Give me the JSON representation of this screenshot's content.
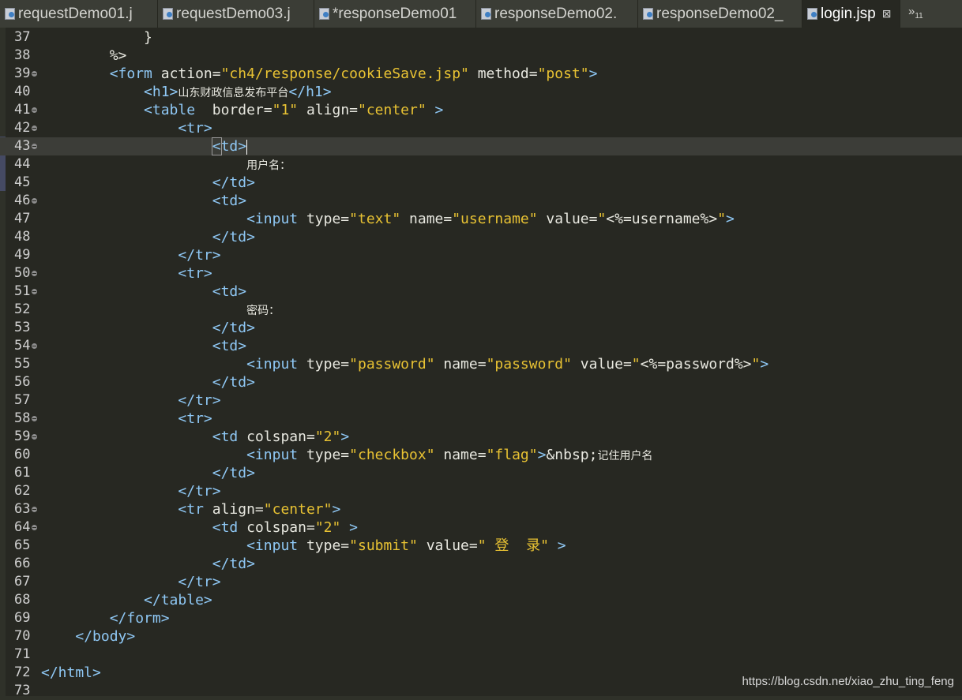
{
  "tabs": [
    {
      "label": "requestDemo01.j",
      "active": false
    },
    {
      "label": "requestDemo03.j",
      "active": false
    },
    {
      "label": "*responseDemo01",
      "active": false
    },
    {
      "label": "responseDemo02.",
      "active": false
    },
    {
      "label": "responseDemo02_",
      "active": false
    },
    {
      "label": "login.jsp",
      "active": true
    }
  ],
  "tab_close_glyph": "⊠",
  "overflow": {
    "glyph": "»",
    "count": "11"
  },
  "colors": {
    "tag": "#8fc8f5",
    "string": "#e8c233",
    "text": "#e8e8e0",
    "background": "#272822"
  },
  "lines": [
    {
      "n": "37",
      "fold": false,
      "segs": [
        [
          "x",
          "            }"
        ]
      ]
    },
    {
      "n": "38",
      "fold": false,
      "segs": [
        [
          "x",
          "        %>"
        ]
      ]
    },
    {
      "n": "39",
      "fold": true,
      "segs": [
        [
          "x",
          "        "
        ],
        [
          "t",
          "<form"
        ],
        [
          "a",
          " action="
        ],
        [
          "s",
          "\"ch4/response/cookieSave.jsp\""
        ],
        [
          "a",
          " method="
        ],
        [
          "s",
          "\"post\""
        ],
        [
          "t",
          ">"
        ]
      ]
    },
    {
      "n": "40",
      "fold": false,
      "segs": [
        [
          "x",
          "            "
        ],
        [
          "t",
          "<h1>"
        ],
        [
          "cjk",
          "山东财政信息发布平台"
        ],
        [
          "t",
          "</h1>"
        ]
      ]
    },
    {
      "n": "41",
      "fold": true,
      "segs": [
        [
          "x",
          "            "
        ],
        [
          "t",
          "<table"
        ],
        [
          "a",
          "  border="
        ],
        [
          "s",
          "\"1\""
        ],
        [
          "a",
          " align="
        ],
        [
          "s",
          "\"center\""
        ],
        [
          "t",
          " >"
        ]
      ]
    },
    {
      "n": "42",
      "fold": true,
      "segs": [
        [
          "x",
          "                "
        ],
        [
          "t",
          "<tr>"
        ]
      ]
    },
    {
      "n": "43",
      "fold": true,
      "current": true,
      "segs": [
        [
          "x",
          "                    "
        ],
        [
          "m",
          "<"
        ],
        [
          "t",
          "td>"
        ],
        [
          "c",
          ""
        ]
      ]
    },
    {
      "n": "44",
      "fold": false,
      "segs": [
        [
          "x",
          "                        "
        ],
        [
          "cjk",
          "用户名："
        ]
      ]
    },
    {
      "n": "45",
      "fold": false,
      "segs": [
        [
          "x",
          "                    "
        ],
        [
          "t",
          "</td>"
        ]
      ]
    },
    {
      "n": "46",
      "fold": true,
      "segs": [
        [
          "x",
          "                    "
        ],
        [
          "t",
          "<td>"
        ]
      ]
    },
    {
      "n": "47",
      "fold": false,
      "segs": [
        [
          "x",
          "                        "
        ],
        [
          "t",
          "<input"
        ],
        [
          "a",
          " type="
        ],
        [
          "s",
          "\"text\""
        ],
        [
          "a",
          " name="
        ],
        [
          "s",
          "\"username\""
        ],
        [
          "a",
          " value="
        ],
        [
          "s",
          "\""
        ],
        [
          "x",
          "<%=username%>"
        ],
        [
          "s",
          "\""
        ],
        [
          "t",
          ">"
        ]
      ]
    },
    {
      "n": "48",
      "fold": false,
      "segs": [
        [
          "x",
          "                    "
        ],
        [
          "t",
          "</td>"
        ]
      ]
    },
    {
      "n": "49",
      "fold": false,
      "segs": [
        [
          "x",
          "                "
        ],
        [
          "t",
          "</tr>"
        ]
      ]
    },
    {
      "n": "50",
      "fold": true,
      "segs": [
        [
          "x",
          "                "
        ],
        [
          "t",
          "<tr>"
        ]
      ]
    },
    {
      "n": "51",
      "fold": true,
      "segs": [
        [
          "x",
          "                    "
        ],
        [
          "t",
          "<td>"
        ]
      ]
    },
    {
      "n": "52",
      "fold": false,
      "segs": [
        [
          "x",
          "                        "
        ],
        [
          "cjk",
          "密码："
        ]
      ]
    },
    {
      "n": "53",
      "fold": false,
      "segs": [
        [
          "x",
          "                    "
        ],
        [
          "t",
          "</td>"
        ]
      ]
    },
    {
      "n": "54",
      "fold": true,
      "segs": [
        [
          "x",
          "                    "
        ],
        [
          "t",
          "<td>"
        ]
      ]
    },
    {
      "n": "55",
      "fold": false,
      "segs": [
        [
          "x",
          "                        "
        ],
        [
          "t",
          "<input"
        ],
        [
          "a",
          " type="
        ],
        [
          "s",
          "\"password\""
        ],
        [
          "a",
          " name="
        ],
        [
          "s",
          "\"password\""
        ],
        [
          "a",
          " value="
        ],
        [
          "s",
          "\""
        ],
        [
          "x",
          "<%=password%>"
        ],
        [
          "s",
          "\""
        ],
        [
          "t",
          ">"
        ]
      ]
    },
    {
      "n": "56",
      "fold": false,
      "segs": [
        [
          "x",
          "                    "
        ],
        [
          "t",
          "</td>"
        ]
      ]
    },
    {
      "n": "57",
      "fold": false,
      "segs": [
        [
          "x",
          "                "
        ],
        [
          "t",
          "</tr>"
        ]
      ]
    },
    {
      "n": "58",
      "fold": true,
      "segs": [
        [
          "x",
          "                "
        ],
        [
          "t",
          "<tr>"
        ]
      ]
    },
    {
      "n": "59",
      "fold": true,
      "segs": [
        [
          "x",
          "                    "
        ],
        [
          "t",
          "<td"
        ],
        [
          "a",
          " colspan="
        ],
        [
          "s",
          "\"2\""
        ],
        [
          "t",
          ">"
        ]
      ]
    },
    {
      "n": "60",
      "fold": false,
      "segs": [
        [
          "x",
          "                        "
        ],
        [
          "t",
          "<input"
        ],
        [
          "a",
          " type="
        ],
        [
          "s",
          "\"checkbox\""
        ],
        [
          "a",
          " name="
        ],
        [
          "s",
          "\"flag\""
        ],
        [
          "t",
          ">"
        ],
        [
          "x",
          "&nbsp;"
        ],
        [
          "cjk",
          "记住用户名"
        ]
      ]
    },
    {
      "n": "61",
      "fold": false,
      "segs": [
        [
          "x",
          "                    "
        ],
        [
          "t",
          "</td>"
        ]
      ]
    },
    {
      "n": "62",
      "fold": false,
      "segs": [
        [
          "x",
          "                "
        ],
        [
          "t",
          "</tr>"
        ]
      ]
    },
    {
      "n": "63",
      "fold": true,
      "segs": [
        [
          "x",
          "                "
        ],
        [
          "t",
          "<tr"
        ],
        [
          "a",
          " align="
        ],
        [
          "s",
          "\"center\""
        ],
        [
          "t",
          ">"
        ]
      ]
    },
    {
      "n": "64",
      "fold": true,
      "segs": [
        [
          "x",
          "                    "
        ],
        [
          "t",
          "<td"
        ],
        [
          "a",
          " colspan="
        ],
        [
          "s",
          "\"2\""
        ],
        [
          "t",
          " >"
        ]
      ]
    },
    {
      "n": "65",
      "fold": false,
      "segs": [
        [
          "x",
          "                        "
        ],
        [
          "t",
          "<input"
        ],
        [
          "a",
          " type="
        ],
        [
          "s",
          "\"submit\""
        ],
        [
          "a",
          " value="
        ],
        [
          "s",
          "\" 登  录\""
        ],
        [
          "t",
          " >"
        ]
      ]
    },
    {
      "n": "66",
      "fold": false,
      "segs": [
        [
          "x",
          "                    "
        ],
        [
          "t",
          "</td>"
        ]
      ]
    },
    {
      "n": "67",
      "fold": false,
      "segs": [
        [
          "x",
          "                "
        ],
        [
          "t",
          "</tr>"
        ]
      ]
    },
    {
      "n": "68",
      "fold": false,
      "segs": [
        [
          "x",
          "            "
        ],
        [
          "t",
          "</table>"
        ]
      ]
    },
    {
      "n": "69",
      "fold": false,
      "segs": [
        [
          "x",
          "        "
        ],
        [
          "t",
          "</form>"
        ]
      ]
    },
    {
      "n": "70",
      "fold": false,
      "segs": [
        [
          "x",
          "    "
        ],
        [
          "t",
          "</body>"
        ]
      ]
    },
    {
      "n": "71",
      "fold": false,
      "segs": []
    },
    {
      "n": "72",
      "fold": false,
      "segs": [
        [
          "t",
          "</html>"
        ]
      ]
    },
    {
      "n": "73",
      "fold": false,
      "segs": []
    }
  ],
  "watermark": "https://blog.csdn.net/xiao_zhu_ting_feng"
}
